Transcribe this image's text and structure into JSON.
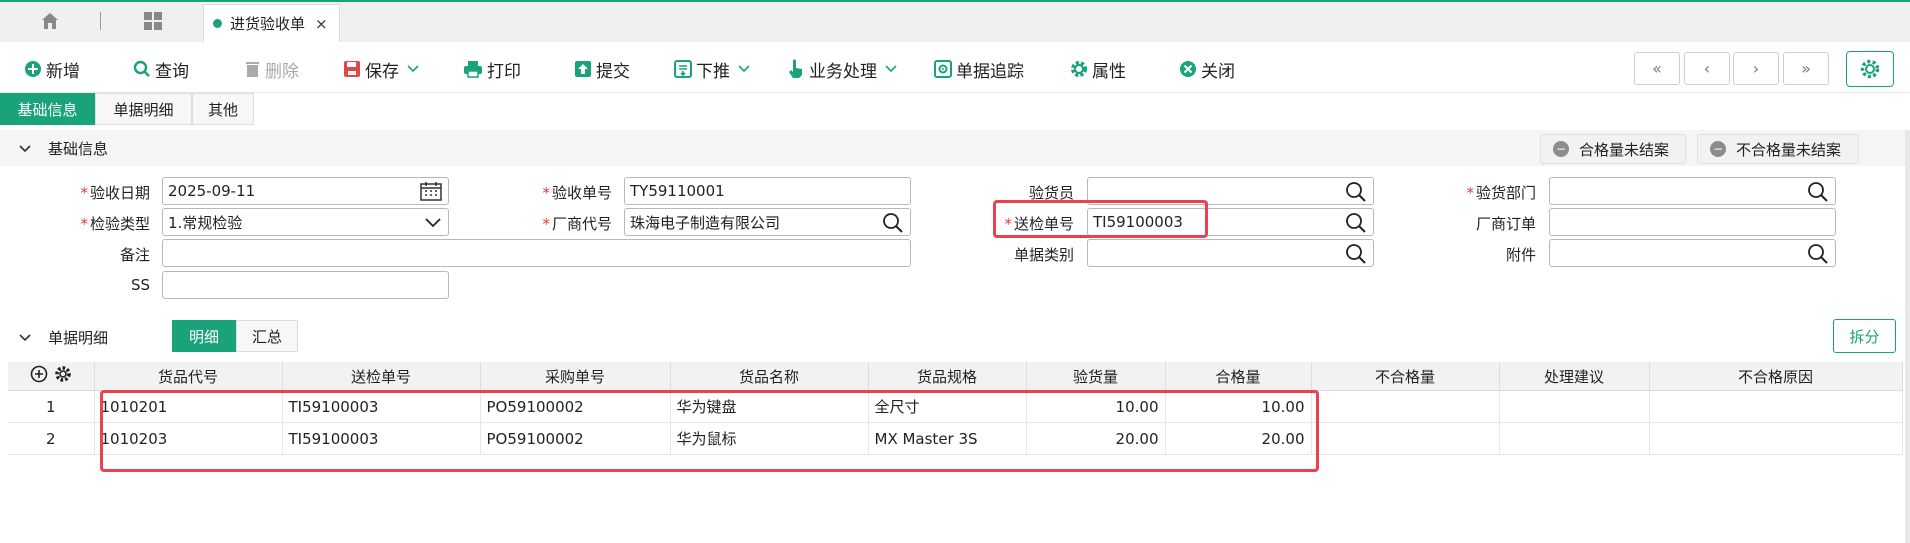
{
  "tab": {
    "title": "进货验收单",
    "close": "×"
  },
  "toolbar": {
    "new": "新增",
    "query": "查询",
    "delete": "删除",
    "save": "保存",
    "print": "打印",
    "submit": "提交",
    "push_down": "下推",
    "business": "业务处理",
    "track": "单据追踪",
    "property": "属性",
    "close": "关闭"
  },
  "nav": {
    "first": "«",
    "prev": "‹",
    "next": "›",
    "last": "»"
  },
  "section_tabs": [
    "基础信息",
    "单据明细",
    "其他"
  ],
  "basic": {
    "title": "基础信息",
    "pill_ok": "合格量未结案",
    "pill_ng": "不合格量未结案"
  },
  "form": {
    "accept_date_label": "验收日期",
    "accept_date": "2025-09-11",
    "accept_no_label": "验收单号",
    "accept_no": "TY59110001",
    "inspector_label": "验货员",
    "inspector": "",
    "dept_label": "验货部门",
    "dept": "",
    "check_type_label": "检验类型",
    "check_type": "1.常规检验",
    "vendor_label": "厂商代号",
    "vendor": "珠海电子制造有限公司",
    "send_no_label": "送检单号",
    "send_no": "TI59100003",
    "vendor_order_label": "厂商订单",
    "vendor_order": "",
    "remark_label": "备注",
    "remark": "",
    "doc_type_label": "单据类别",
    "doc_type": "",
    "attach_label": "附件",
    "attach": "",
    "ss_label": "SS",
    "ss": ""
  },
  "detail": {
    "title": "单据明细",
    "tab_detail": "明细",
    "tab_summary": "汇总",
    "split": "拆分",
    "columns": [
      "货品代号",
      "送检单号",
      "采购单号",
      "货品名称",
      "货品规格",
      "验货量",
      "合格量",
      "不合格量",
      "处理建议",
      "不合格原因"
    ],
    "rows": [
      {
        "idx": "1",
        "code": "1010201",
        "send_no": "TI59100003",
        "po": "PO59100002",
        "name": "华为键盘",
        "spec": "全尺寸",
        "qty": "10.00",
        "ok": "10.00",
        "ng": "",
        "advice": "",
        "reason": ""
      },
      {
        "idx": "2",
        "code": "1010203",
        "send_no": "TI59100003",
        "po": "PO59100002",
        "name": "华为鼠标",
        "spec": "MX Master 3S",
        "qty": "20.00",
        "ok": "20.00",
        "ng": "",
        "advice": "",
        "reason": ""
      }
    ]
  },
  "colors": {
    "accent": "#1aa37a",
    "highlight": "#e8434e",
    "required": "#e23b3b"
  }
}
